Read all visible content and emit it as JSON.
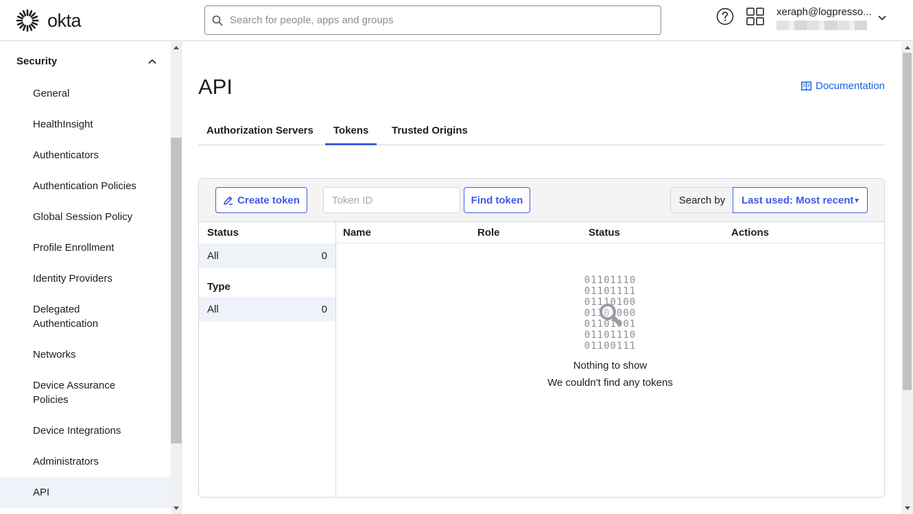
{
  "header": {
    "brand": "okta",
    "search_placeholder": "Search for people, apps and groups",
    "user_name": "xeraph@logpresso..."
  },
  "sidebar": {
    "section_title": "Security",
    "items": [
      {
        "label": "General"
      },
      {
        "label": "HealthInsight"
      },
      {
        "label": "Authenticators"
      },
      {
        "label": "Authentication Policies"
      },
      {
        "label": "Global Session Policy"
      },
      {
        "label": "Profile Enrollment"
      },
      {
        "label": "Identity Providers"
      },
      {
        "label": "Delegated Authentication"
      },
      {
        "label": "Networks"
      },
      {
        "label": "Device Assurance Policies"
      },
      {
        "label": "Device Integrations"
      },
      {
        "label": "Administrators"
      },
      {
        "label": "API"
      }
    ]
  },
  "main": {
    "title": "API",
    "doc_link": "Documentation",
    "tabs": [
      {
        "label": "Authorization Servers"
      },
      {
        "label": "Tokens"
      },
      {
        "label": "Trusted Origins"
      }
    ],
    "active_tab": "Tokens",
    "toolbar": {
      "create_label": "Create token",
      "token_placeholder": "Token ID",
      "find_label": "Find token",
      "search_by_label": "Search by",
      "search_by_value": "Last used: Most recent"
    },
    "filters": {
      "status_title": "Status",
      "status_all_label": "All",
      "status_all_count": "0",
      "type_title": "Type",
      "type_all_label": "All",
      "type_all_count": "0"
    },
    "table": {
      "columns": [
        "Name",
        "Role",
        "Status",
        "Actions"
      ]
    },
    "empty": {
      "binary_lines": [
        "01101110",
        "01101111",
        "01110100",
        "01101000",
        "01101001",
        "01101110",
        "01100111"
      ],
      "title": "Nothing to show",
      "subtitle": "We couldn't find any tokens"
    }
  }
}
